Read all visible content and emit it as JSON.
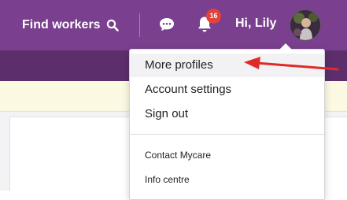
{
  "header": {
    "find_workers_label": "Find workers",
    "notification_count": "16",
    "greeting": "Hi, Lily",
    "icons": [
      "search-icon",
      "chat-icon",
      "bell-icon",
      "avatar"
    ]
  },
  "user_menu": {
    "items": [
      {
        "label": "More profiles"
      },
      {
        "label": "Account settings"
      },
      {
        "label": "Sign out"
      }
    ],
    "secondary_items": [
      {
        "label": "Contact Mycare"
      },
      {
        "label": "Info centre"
      }
    ]
  },
  "colors": {
    "header_bg": "#7a3f8e",
    "subbar_bg": "#5c2f6c",
    "badge": "#e0433a",
    "annotation_arrow": "#e02a2a"
  }
}
